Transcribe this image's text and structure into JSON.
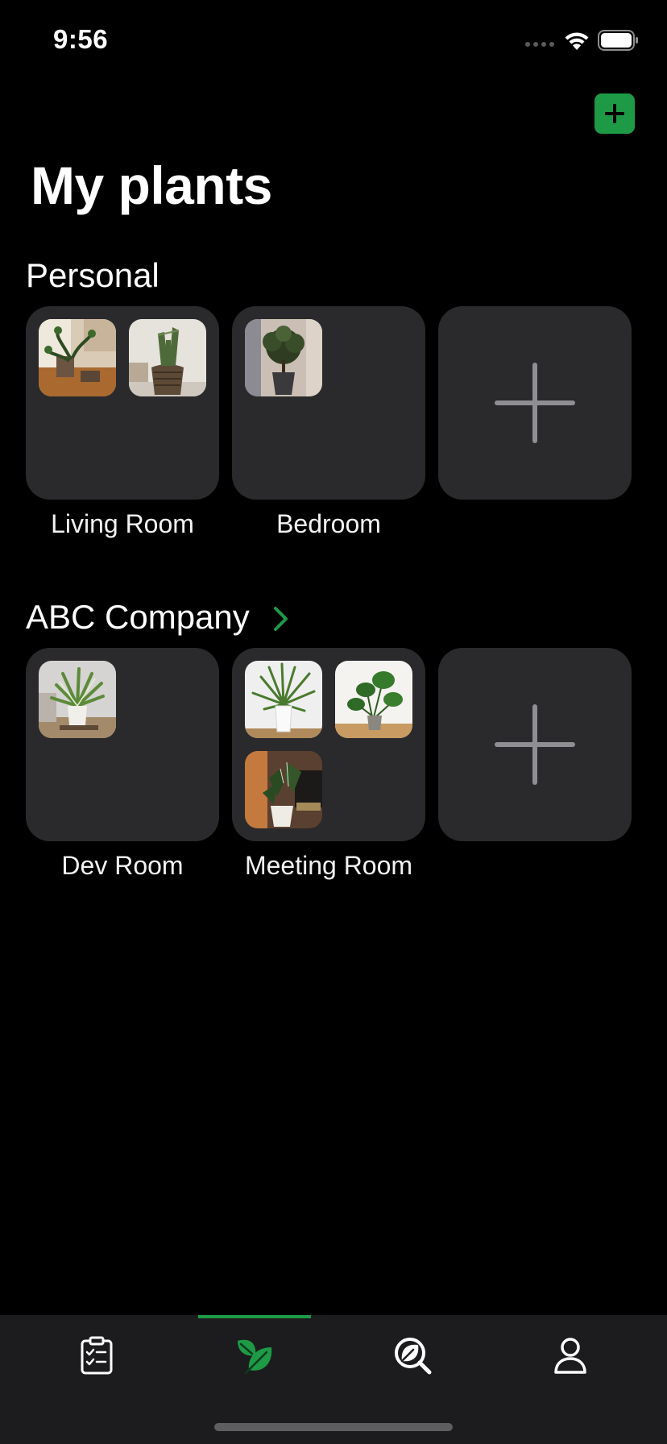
{
  "status_bar": {
    "time": "9:56"
  },
  "header": {
    "title": "My plants",
    "add_button_icon": "plus-icon"
  },
  "sections": [
    {
      "title": "Personal",
      "has_chevron": false,
      "rooms": [
        {
          "name": "Living Room",
          "plant_count": 2
        },
        {
          "name": "Bedroom",
          "plant_count": 1
        }
      ],
      "add_room_icon": "plus-icon"
    },
    {
      "title": "ABC Company",
      "has_chevron": true,
      "rooms": [
        {
          "name": "Dev Room",
          "plant_count": 1
        },
        {
          "name": "Meeting Room",
          "plant_count": 3
        }
      ],
      "add_room_icon": "plus-icon"
    }
  ],
  "tab_bar": {
    "tabs": [
      {
        "icon": "clipboard-checklist-icon",
        "selected": false
      },
      {
        "icon": "leaf-icon",
        "selected": true
      },
      {
        "icon": "leaf-search-icon",
        "selected": false
      },
      {
        "icon": "person-icon",
        "selected": false
      }
    ]
  },
  "colors": {
    "accent": "#1e9a46",
    "background": "#000000",
    "card": "#2a2a2c",
    "tab_bar": "#1c1c1e"
  }
}
